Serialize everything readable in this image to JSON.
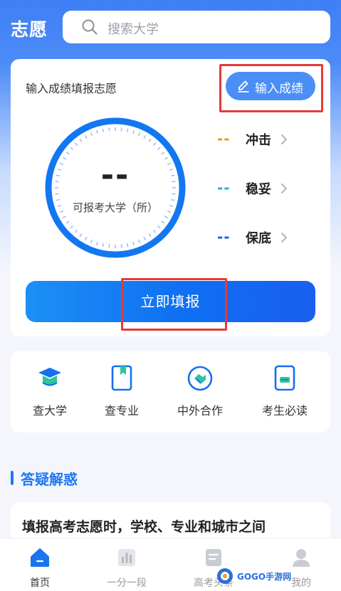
{
  "header": {
    "title": "志愿",
    "search_placeholder": "搜索大学",
    "search_icon": "search-icon"
  },
  "score_card": {
    "lead_text": "输入成绩填报志愿",
    "enter_button_label": "输入成绩",
    "enter_icon": "edit-icon",
    "dial_value": "--",
    "dial_caption": "可报考大学（所）",
    "levels": [
      {
        "name": "冲击",
        "value": "--",
        "color": "#f5941d"
      },
      {
        "name": "稳妥",
        "value": "--",
        "color": "#29a9f2"
      },
      {
        "name": "保底",
        "value": "--",
        "color": "#1d5fe8"
      }
    ],
    "submit_label": "立即填报"
  },
  "tools": [
    {
      "label": "查大学",
      "icon": "graduation-cap-icon"
    },
    {
      "label": "查专业",
      "icon": "book-bookmark-icon"
    },
    {
      "label": "中外合作",
      "icon": "handshake-icon"
    },
    {
      "label": "考生必读",
      "icon": "document-icon"
    }
  ],
  "section": {
    "title": "答疑解惑"
  },
  "article": {
    "title": "填报高考志愿时，学校、专业和城市之间"
  },
  "tabbar": {
    "items": [
      {
        "label": "首页",
        "icon": "home-icon",
        "active": true
      },
      {
        "label": "一分一段",
        "icon": "bar-chart-icon",
        "active": false
      },
      {
        "label": "高考头条",
        "icon": "news-icon",
        "active": false
      },
      {
        "label": "我的",
        "icon": "profile-icon",
        "active": false
      }
    ]
  },
  "watermark": {
    "text": "GOGO手游网"
  },
  "colors": {
    "brand_blue": "#3f7ff6",
    "button_blue": "#0f6ff2",
    "highlight_red": "#e43a3a"
  }
}
